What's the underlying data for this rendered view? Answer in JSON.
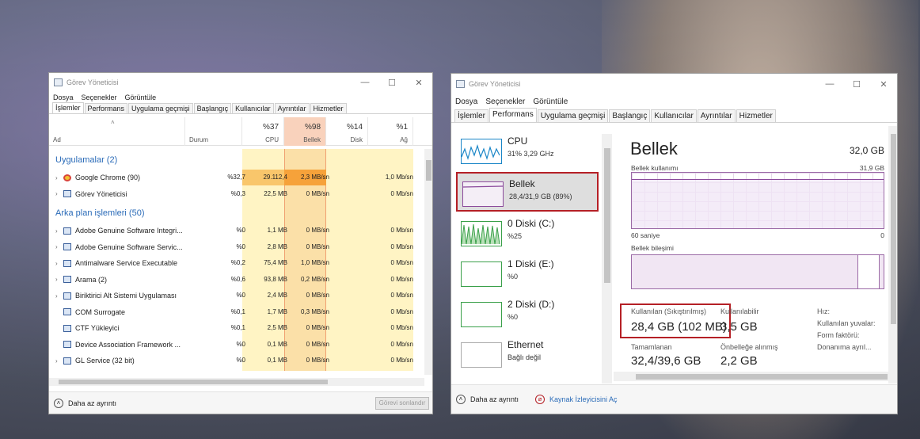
{
  "left_window": {
    "title": "Görev Yöneticisi",
    "controls": [
      "—",
      "☐",
      "✕"
    ],
    "menu": [
      "Dosya",
      "Seçenekler",
      "Görüntüle"
    ],
    "tabs": [
      "İşlemler",
      "Performans",
      "Uygulama geçmişi",
      "Başlangıç",
      "Kullanıcılar",
      "Ayrıntılar",
      "Hizmetler"
    ],
    "active_tab": 0,
    "columns": {
      "name": "Ad",
      "status": "Durum",
      "cpu": {
        "pct": "%37",
        "label": "CPU"
      },
      "memory": {
        "pct": "%98",
        "label": "Bellek"
      },
      "disk": {
        "pct": "%14",
        "label": "Disk"
      },
      "network": {
        "pct": "%1",
        "label": "Ağ"
      }
    },
    "group_apps": "Uygulamalar (2)",
    "apps": [
      {
        "name": "Google Chrome (90)",
        "cpu": "%32,7",
        "mem": "29.112,4",
        "disk": "2,3 MB/sn",
        "net": "1,0 Mb/sn",
        "icon": "chrome-icon"
      },
      {
        "name": "Görev Yöneticisi",
        "cpu": "%0,3",
        "mem": "22,5 MB",
        "disk": "0 MB/sn",
        "net": "0 Mb/sn",
        "icon": "task-manager-icon"
      }
    ],
    "group_bg": "Arka plan işlemleri (50)",
    "background": [
      {
        "name": "Adobe Genuine Software Integri...",
        "cpu": "%0",
        "mem": "1,1 MB",
        "disk": "0 MB/sn",
        "net": "0 Mb/sn",
        "expand": true
      },
      {
        "name": "Adobe Genuine Software Servic...",
        "cpu": "%0",
        "mem": "2,8 MB",
        "disk": "0 MB/sn",
        "net": "0 Mb/sn",
        "expand": true
      },
      {
        "name": "Antimalware Service Executable",
        "cpu": "%0,2",
        "mem": "75,4 MB",
        "disk": "1,0 MB/sn",
        "net": "0 Mb/sn",
        "expand": true
      },
      {
        "name": "Arama (2)",
        "cpu": "%0,6",
        "mem": "93,8 MB",
        "disk": "0,2 MB/sn",
        "net": "0 Mb/sn",
        "expand": true
      },
      {
        "name": "Biriktirici Alt Sistemi Uygulaması",
        "cpu": "%0",
        "mem": "2,4 MB",
        "disk": "0 MB/sn",
        "net": "0 Mb/sn",
        "expand": true
      },
      {
        "name": "COM Surrogate",
        "cpu": "%0,1",
        "mem": "1,7 MB",
        "disk": "0,3 MB/sn",
        "net": "0 Mb/sn",
        "expand": false
      },
      {
        "name": "CTF Yükleyici",
        "cpu": "%0,1",
        "mem": "2,5 MB",
        "disk": "0 MB/sn",
        "net": "0 Mb/sn",
        "expand": false
      },
      {
        "name": "Device Association Framework ...",
        "cpu": "%0",
        "mem": "0,1 MB",
        "disk": "0 MB/sn",
        "net": "0 Mb/sn",
        "expand": false
      },
      {
        "name": "GL Service (32 bit)",
        "cpu": "%0",
        "mem": "0,1 MB",
        "disk": "0 MB/sn",
        "net": "0 Mb/sn",
        "expand": true
      }
    ],
    "footer_less": "Daha az ayrıntı",
    "footer_end": "Görevi sonlandır"
  },
  "right_window": {
    "title": "Görev Yöneticisi",
    "controls": [
      "—",
      "☐",
      "✕"
    ],
    "menu": [
      "Dosya",
      "Seçenekler",
      "Görüntüle"
    ],
    "tabs": [
      "İşlemler",
      "Performans",
      "Uygulama geçmişi",
      "Başlangıç",
      "Kullanıcılar",
      "Ayrıntılar",
      "Hizmetler"
    ],
    "active_tab": 1,
    "sidebar": [
      {
        "title": "CPU",
        "sub": "31% 3,29 GHz",
        "color": "#1a86c7"
      },
      {
        "title": "Bellek",
        "sub": "28,4/31,9 GB (89%)",
        "color": "#8b4a9c"
      },
      {
        "title": "0 Diski (C:)",
        "sub": "%25",
        "color": "#3aa04a"
      },
      {
        "title": "1 Diski (E:)",
        "sub": "%0",
        "color": "#3aa04a"
      },
      {
        "title": "2 Diski (D:)",
        "sub": "%0",
        "color": "#3aa04a"
      },
      {
        "title": "Ethernet",
        "sub": "Bağlı değil",
        "color": "#aaaaaa"
      }
    ],
    "main": {
      "title": "Bellek",
      "total": "32,0 GB",
      "usage_label": "Bellek kullanımı",
      "usage_max": "31,9 GB",
      "usage_fraction": 0.89,
      "time_label": "60 saniye",
      "time_end": "0",
      "composition_label": "Bellek bileşimi",
      "in_use_label": "Kullanılan (Sıkıştırılmış)",
      "in_use_value": "28,4 GB (102 MB)",
      "available_label": "Kullanılabilir",
      "available_value": "3,5 GB",
      "committed_label": "Tamamlanan",
      "committed_value": "32,4/39,6 GB",
      "cached_label": "Önbelleğe alınmış",
      "cached_value": "2,2 GB",
      "speed_label": "Hız:",
      "slots_label": "Kullanılan yuvalar:",
      "form_label": "Form faktörü:",
      "reserved_label": "Donanıma ayrıl..."
    },
    "footer_less": "Daha az ayrıntı",
    "footer_monitor": "Kaynak İzleyicisini Aç"
  }
}
